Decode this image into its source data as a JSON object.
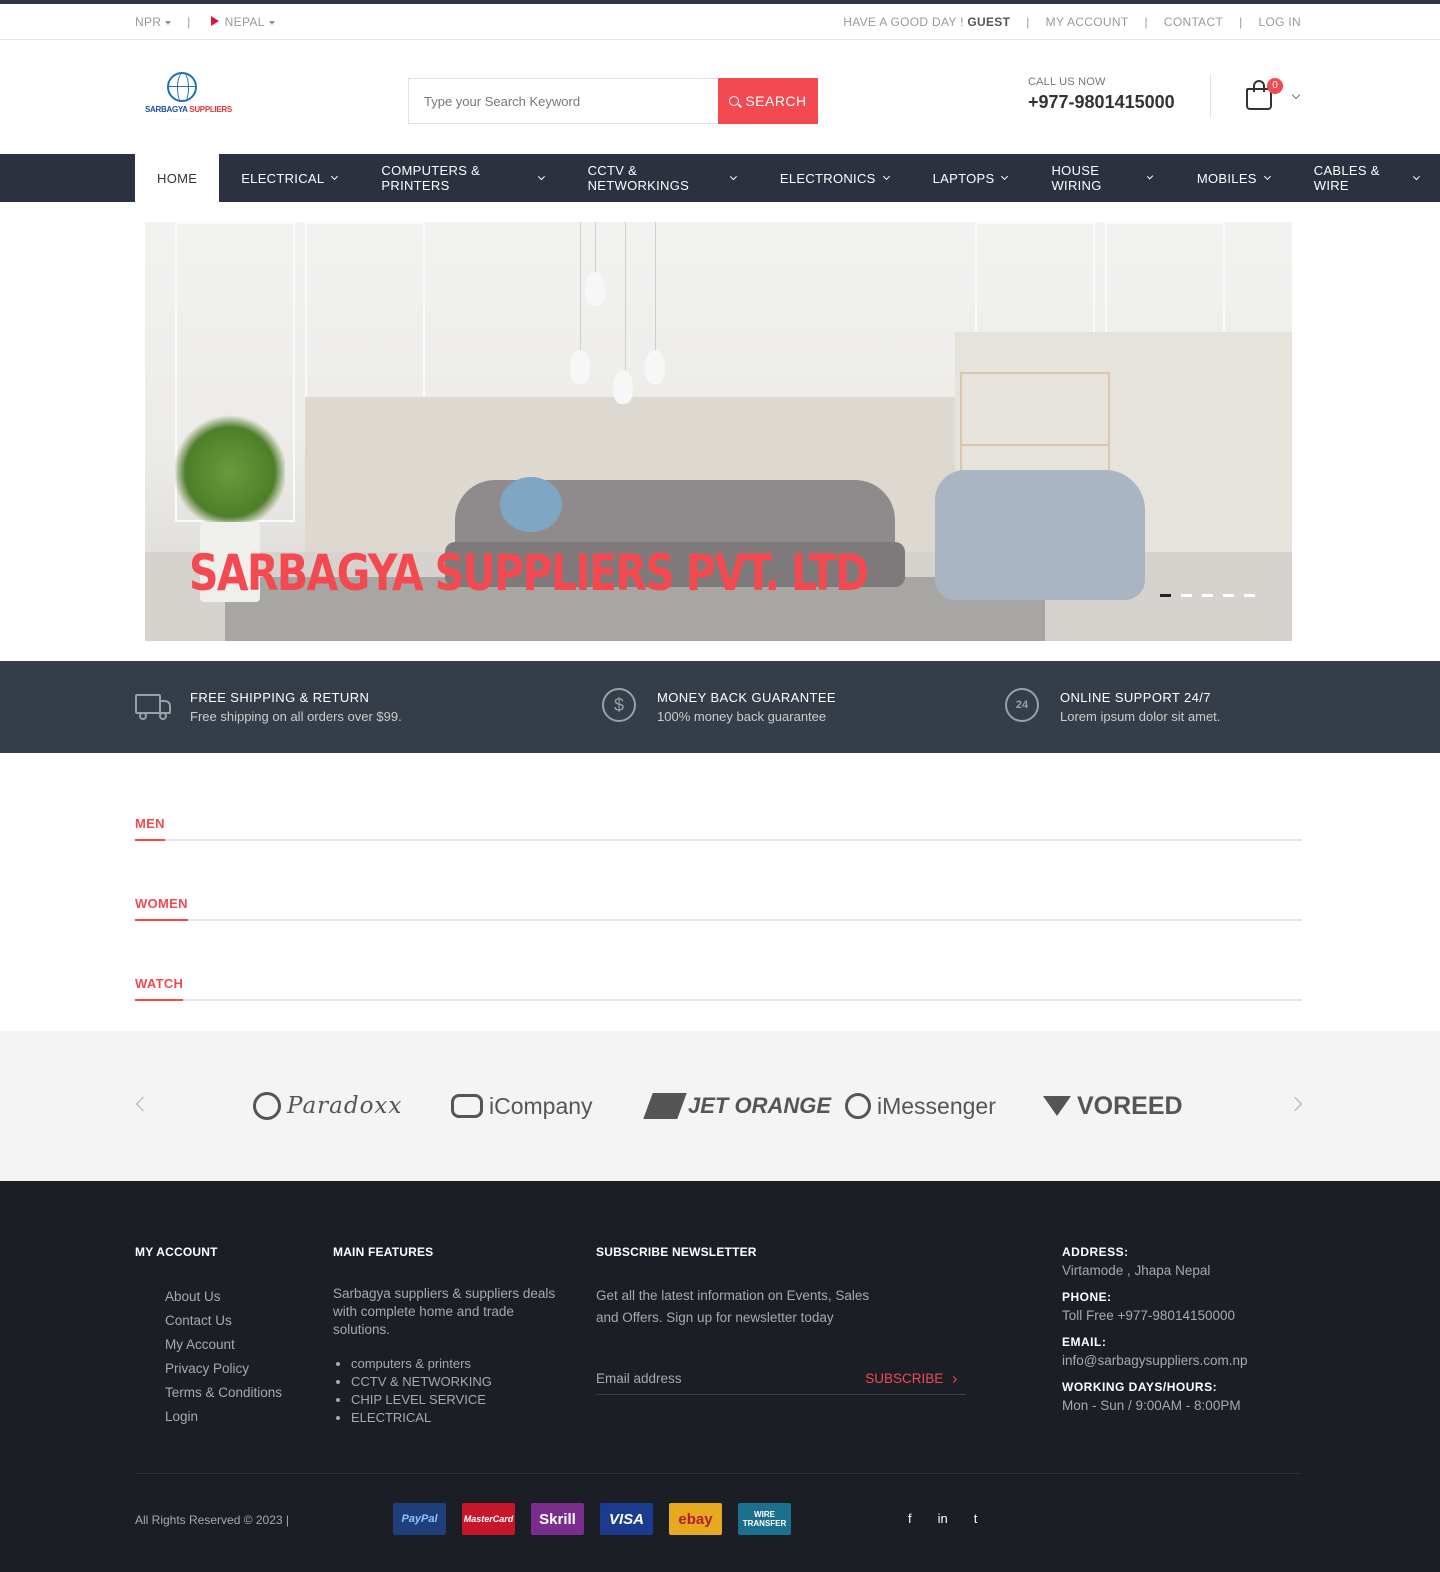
{
  "topbar": {
    "currency": "NPR",
    "country": "NEPAL",
    "greeting_prefix": "HAVE A GOOD DAY !",
    "greeting_user": "GUEST",
    "links": [
      "MY ACCOUNT",
      "CONTACT",
      "LOG IN"
    ]
  },
  "header": {
    "logo_text_1": "SARBAGYA",
    "logo_text_2": "SUPPLIERS",
    "search_placeholder": "Type your Search Keyword",
    "search_button": "SEARCH",
    "call_label": "CALL US NOW",
    "phone": "+977-9801415000",
    "cart_count": "0"
  },
  "nav": {
    "items": [
      {
        "label": "HOME",
        "active": true
      },
      {
        "label": "ELECTRICAL"
      },
      {
        "label": "COMPUTERS & PRINTERS"
      },
      {
        "label": "CCTV & NETWORKINGS"
      },
      {
        "label": "ELECTRONICS"
      },
      {
        "label": "LAPTOPS"
      },
      {
        "label": "HOUSE WIRING"
      },
      {
        "label": "MOBILES"
      },
      {
        "label": "CABLES & WIRE"
      }
    ]
  },
  "hero": {
    "title": "SARBAGYA SUPPLIERS PVT. LTD",
    "slides": 5,
    "active_slide": 1
  },
  "features": [
    {
      "icon": "truck-icon",
      "title": "FREE SHIPPING & RETURN",
      "subtitle": "Free shipping on all orders over $99."
    },
    {
      "icon": "dollar-icon",
      "title": "MONEY BACK GUARANTEE",
      "subtitle": "100% money back guarantee"
    },
    {
      "icon": "support-24-icon",
      "title": "ONLINE SUPPORT 24/7",
      "subtitle": "Lorem ipsum dolor sit amet."
    }
  ],
  "sections": [
    "MEN",
    "WOMEN",
    "WATCH"
  ],
  "brands": [
    "Paradoxx",
    "iCompany",
    "JET ORANGE",
    "iMessenger",
    "VOREED"
  ],
  "footer": {
    "my_account": {
      "title": "MY ACCOUNT",
      "links": [
        "About Us",
        "Contact Us",
        "My Account",
        "Privacy Policy",
        "Terms & Conditions",
        "Login"
      ]
    },
    "main_features": {
      "title": "MAIN FEATURES",
      "text": "Sarbagya suppliers & suppliers deals with complete home and trade solutions.",
      "items": [
        "computers & printers",
        "CCTV & NETWORKING",
        "CHIP LEVEL SERVICE",
        "ELECTRICAL"
      ]
    },
    "newsletter": {
      "title": "SUBSCRIBE NEWSLETTER",
      "text": "Get all the latest information on Events, Sales and Offers. Sign up for newsletter today",
      "placeholder": "Email address",
      "button": "SUBSCRIBE"
    },
    "contact": {
      "address_label": "ADDRESS:",
      "address": "Virtamode , Jhapa Nepal",
      "phone_label": "PHONE:",
      "phone": "Toll Free +977-98014150000",
      "email_label": "EMAIL:",
      "email": "info@sarbagysuppliers.com.np",
      "hours_label": "WORKING DAYS/HOURS:",
      "hours": "Mon - Sun / 9:00AM - 8:00PM"
    },
    "copyright": "All Rights Reserved © 2023 |",
    "payments": [
      "PayPal",
      "MasterCard",
      "Skrill",
      "VISA",
      "ebay",
      "WIRE TRANSFER"
    ],
    "social": [
      "f",
      "in",
      "t"
    ]
  },
  "colors": {
    "accent": "#f34a52",
    "nav_bg": "#2c3140",
    "features_bg": "#353d48",
    "footer_bg": "#1b1e25"
  }
}
